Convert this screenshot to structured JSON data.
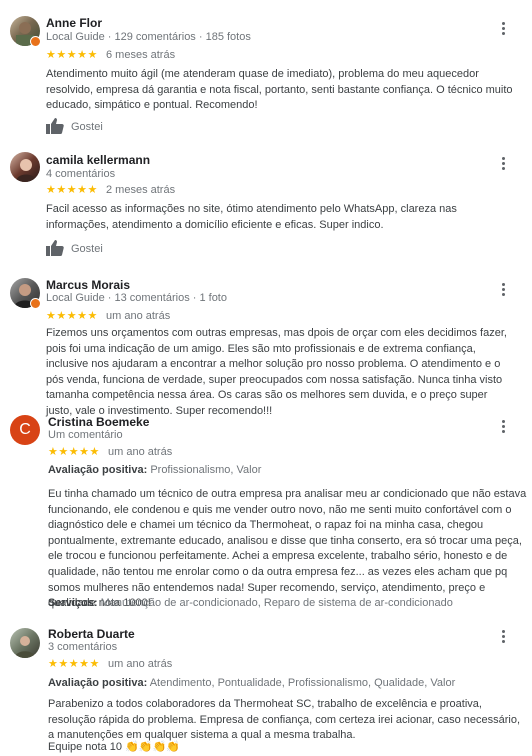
{
  "reviews": [
    {
      "name": "Anne Flor",
      "meta": "Local Guide · 129 comentários · 185 fotos",
      "stars": "★★★★★",
      "when": "6 meses atrás",
      "text": "Atendimento muito ágil (me atenderam quase de imediato), problema do meu aquecedor resolvido, empresa dá garantia e nota fiscal, portanto, senti bastante confiança. O técnico muito educado, simpático e pontual. Recomendo!",
      "like_label": "Gostei"
    },
    {
      "name": "camila kellermann",
      "meta": "4 comentários",
      "stars": "★★★★★",
      "when": "2 meses atrás",
      "text": "Facil acesso as informações no site, ótimo atendimento pelo WhatsApp, clareza nas informações, atendimento a domicílio eficiente e eficas. Super indico.",
      "like_label": "Gostei"
    },
    {
      "name": "Marcus Morais",
      "meta": "Local Guide · 13 comentários · 1 foto",
      "stars": "★★★★★",
      "when": "um ano atrás",
      "text": "Fizemos uns orçamentos com outras empresas, mas dpois de orçar com eles decidimos fazer, pois foi uma indicação de um amigo. Eles são mto profissionais e de extrema confiança, inclusive nos ajudaram a encontrar a melhor solução pro nosso problema. O atendimento e o pós venda, funciona de verdade, super preocupados com nossa satisfação. Nunca tinha visto tamanha competência nessa área. Os caras são os melhores sem duvida, e o preço super justo, vale o investimento. Super recomendo!!!"
    },
    {
      "name": "Cristina Boemeke",
      "initial": "C",
      "meta": "Um comentário",
      "stars": "★★★★★",
      "when": "um ano atrás",
      "positive_label": "Avaliação positiva:",
      "positive_value": "Profissionalismo, Valor",
      "text": "Eu tinha chamado um técnico de outra empresa pra analisar meu ar condicionado que não estava funcionando, ele condenou e quis me vender outro novo, não me senti muito confortável com o diagnóstico dele e chamei um técnico da Thermoheat, o rapaz foi na minha casa, chegou pontualmente, extremante educado, analisou e disse que tinha conserto, era só trocar uma peça, ele trocou e funcionou perfeitamente. Achei a empresa excelente, trabalho sério, honesto e de qualidade, não tentou me enrolar como o da outra empresa fez... as vezes eles acham que pq somos mulheres não entendemos nada! Super recomendo, serviço, atendimento, preço e qualidade nota 1000!",
      "services_label": "Serviços:",
      "services_value": "Manutenção de ar-condicionado, Reparo de sistema de ar-condicionado"
    },
    {
      "name": "Roberta Duarte",
      "meta": "3 comentários",
      "stars": "★★★★★",
      "when": "um ano atrás",
      "positive_label": "Avaliação positiva:",
      "positive_value": "Atendimento, Pontualidade, Profissionalismo, Qualidade, Valor",
      "text": "Parabenizo a todos colaboradores da Thermoheat SC, trabalho de excelência e proativa, resolução rápida do problema. Empresa de confiança, com certeza irei acionar,  caso necessário, a manutenções em qualquer sistema a qual a mesma trabalha.",
      "text2": "Equipe nota 10 👏👏👏👏"
    }
  ],
  "colors": {
    "star": "#fbbc04",
    "local_guide_badge": "#e8711a",
    "letter_avatar": "#d84315"
  },
  "icons": {
    "more": "more-vert-icon",
    "like": "thumbs-up-icon",
    "badge": "local-guide-badge-icon"
  }
}
